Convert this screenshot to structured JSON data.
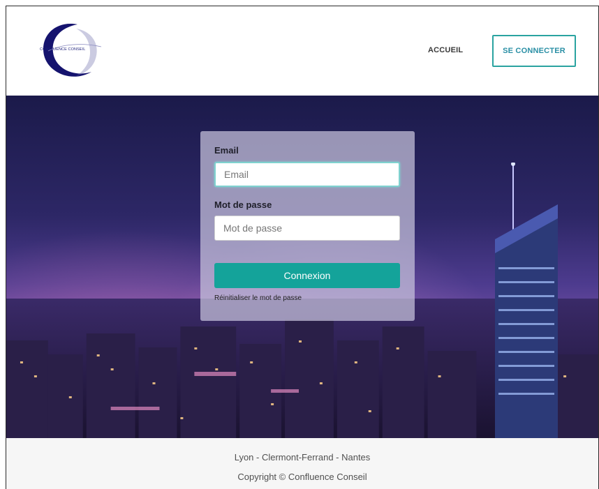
{
  "header": {
    "logo_text": "CONFLUENCE CONSEIL",
    "nav": {
      "home_label": "ACCUEIL",
      "login_label": "SE CONNECTER"
    }
  },
  "login_form": {
    "email_label": "Email",
    "email_placeholder": "Email",
    "password_label": "Mot de passe",
    "password_placeholder": "Mot de passe",
    "submit_label": "Connexion",
    "reset_link": "Réinitialiser le mot de passe"
  },
  "footer": {
    "cities": "Lyon - Clermont-Ferrand - Nantes",
    "copyright": "Copyright © Confluence Conseil"
  },
  "colors": {
    "accent": "#14a39a",
    "nav_border": "#2aa3a0",
    "logo_blue": "#1c1f7a"
  }
}
